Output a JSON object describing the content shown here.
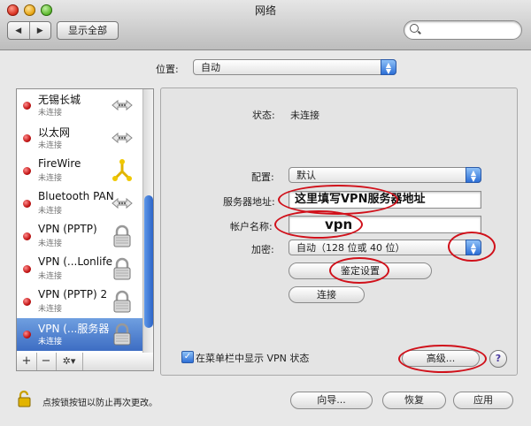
{
  "window": {
    "title": "网络"
  },
  "toolbar": {
    "back_label": "◀",
    "forward_label": "▶",
    "show_all_label": "显示全部"
  },
  "location": {
    "label": "位置:",
    "value": "自动"
  },
  "services": [
    {
      "name": "无锡长城",
      "status": "未连接",
      "icon": "ethernet-arrows-icon",
      "selected": false
    },
    {
      "name": "以太网",
      "status": "未连接",
      "icon": "ethernet-arrows-icon",
      "selected": false
    },
    {
      "name": "FireWire",
      "status": "未连接",
      "icon": "firewire-icon",
      "selected": false
    },
    {
      "name": "Bluetooth PAN",
      "status": "未连接",
      "icon": "ethernet-arrows-icon",
      "selected": false
    },
    {
      "name": "VPN (PPTP)",
      "status": "未连接",
      "icon": "lock-icon",
      "selected": false
    },
    {
      "name": "VPN (...Lonlife",
      "status": "未连接",
      "icon": "lock-icon",
      "selected": false
    },
    {
      "name": "VPN (PPTP) 2",
      "status": "未连接",
      "icon": "lock-icon",
      "selected": false
    },
    {
      "name": "VPN (...服务器",
      "status": "未连接",
      "icon": "lock-icon",
      "selected": true
    }
  ],
  "list_bar": {
    "add": "+",
    "remove": "−",
    "gear": "✲▾"
  },
  "detail": {
    "status_label": "状态:",
    "status_value": "未连接",
    "config_label": "配置:",
    "config_value": "默认",
    "server_label": "服务器地址:",
    "server_value": "这里填写VPN服务器地址",
    "account_label": "帐户名称:",
    "account_value": "vpn",
    "encryption_label": "加密:",
    "encryption_value": "自动（128 位或 40 位）",
    "auth_button": "鉴定设置",
    "connect_button": "连接",
    "show_status_label": "在菜单栏中显示 VPN 状态",
    "show_status_checked": true,
    "advanced_button": "高级...",
    "help": "?"
  },
  "footer": {
    "lock_text": "点按锁按钮以防止再次更改。",
    "assistant_button": "向导...",
    "revert_button": "恢复",
    "apply_button": "应用"
  },
  "colors": {
    "annotation_red": "#d0101a",
    "selection_blue": "#3d6dc3",
    "status_red": "#c21414"
  }
}
